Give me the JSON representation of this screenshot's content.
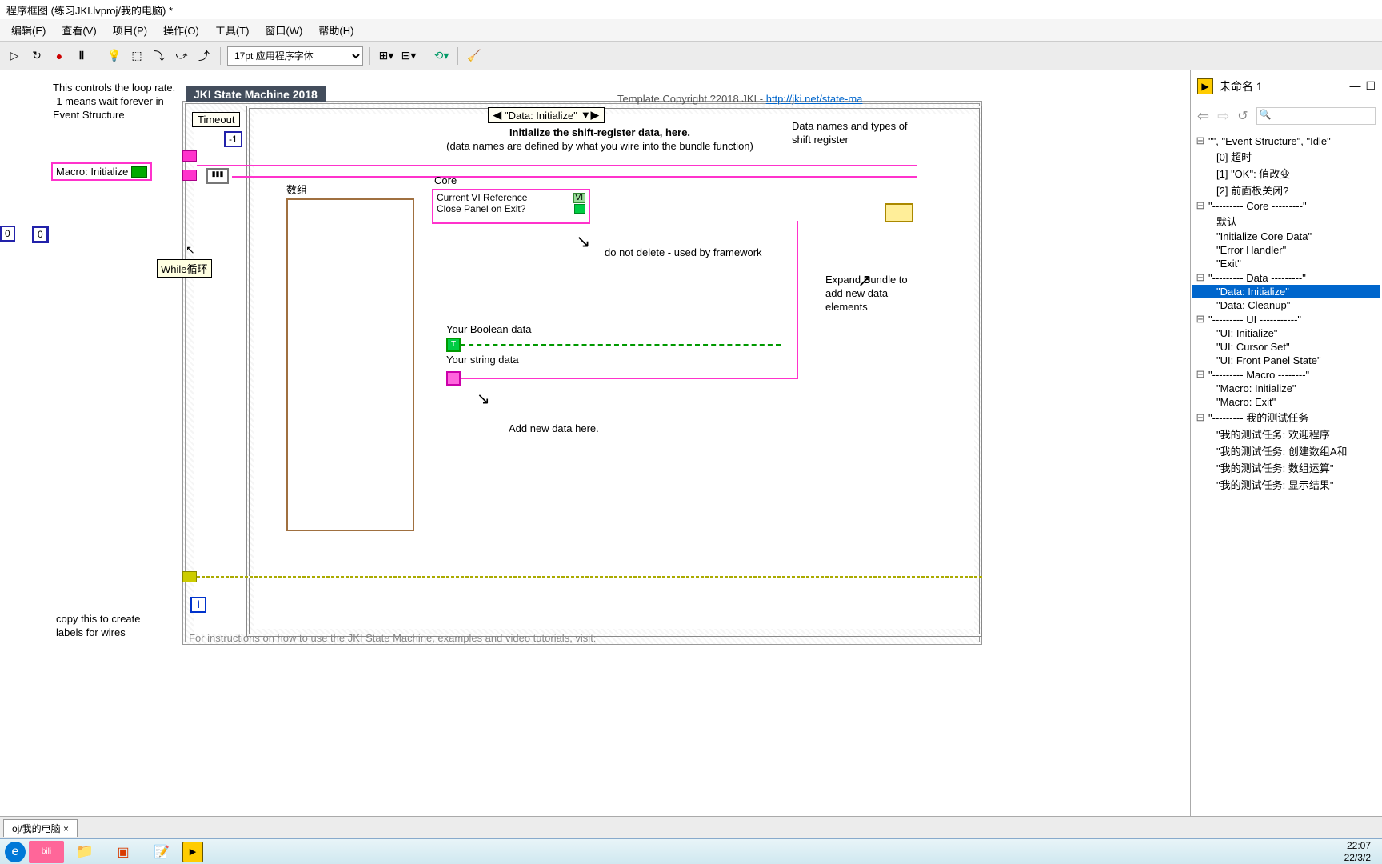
{
  "window": {
    "title": "程序框图 (练习JKI.lvproj/我的电脑) *"
  },
  "menu": {
    "edit": "编辑(E)",
    "view": "查看(V)",
    "project": "项目(P)",
    "operate": "操作(O)",
    "tools": "工具(T)",
    "window": "窗口(W)",
    "help": "帮助(H)"
  },
  "toolbar": {
    "font": "17pt 应用程序字体"
  },
  "right_panel": {
    "title": "未命名 1",
    "search_ph": "",
    "items": [
      {
        "t": "\"\", \"Event Structure\", \"Idle\"",
        "i": 0,
        "g": true
      },
      {
        "t": "[0] 超时",
        "i": 1
      },
      {
        "t": "[1] \"OK\": 值改变",
        "i": 1
      },
      {
        "t": "[2] 前面板关闭?",
        "i": 1
      },
      {
        "t": "\"--------- Core ---------\"",
        "i": 0,
        "g": true
      },
      {
        "t": "默认",
        "i": 1
      },
      {
        "t": "\"Initialize Core Data\"",
        "i": 1
      },
      {
        "t": "\"Error Handler\"",
        "i": 1
      },
      {
        "t": "\"Exit\"",
        "i": 1
      },
      {
        "t": "\"--------- Data ---------\"",
        "i": 0,
        "g": true
      },
      {
        "t": "\"Data: Initialize\"",
        "i": 1,
        "sel": true
      },
      {
        "t": "\"Data: Cleanup\"",
        "i": 1
      },
      {
        "t": "\"--------- UI -----------\"",
        "i": 0,
        "g": true
      },
      {
        "t": "\"UI: Initialize\"",
        "i": 1
      },
      {
        "t": "\"UI: Cursor Set\"",
        "i": 1
      },
      {
        "t": "\"UI: Front Panel State\"",
        "i": 1
      },
      {
        "t": "\"--------- Macro --------\"",
        "i": 0,
        "g": true
      },
      {
        "t": "\"Macro: Initialize\"",
        "i": 1
      },
      {
        "t": "\"Macro: Exit\"",
        "i": 1
      },
      {
        "t": "\"--------- 我的测试任务",
        "i": 0,
        "g": true
      },
      {
        "t": "\"我的测试任务: 欢迎程序",
        "i": 1
      },
      {
        "t": "\"我的测试任务: 创建数组A和",
        "i": 1
      },
      {
        "t": "\"我的测试任务: 数组运算\"",
        "i": 1
      },
      {
        "t": "\"我的测试任务: 显示结果\"",
        "i": 1
      }
    ]
  },
  "diagram": {
    "jki_title": "JKI State Machine 2018",
    "copyright_pre": "Template Copyright ?2018 JKI - ",
    "copyright_link": "http://jki.net/state-ma",
    "loop_comment": "This controls the loop rate. -1 means wait forever in Event Structure",
    "timeout": "Timeout",
    "timeout_val": "-1",
    "macro_init": "Macro: Initialize",
    "case_label": "\"Data: Initialize\"",
    "init_title": "Initialize the shift-register data, here.",
    "init_sub": "(data names are defined by what you wire into the bundle function)",
    "core": "Core",
    "vi_ref": "Current VI Reference",
    "close_panel": "Close Panel on Exit?",
    "array_label": "数组",
    "no_delete": "do not delete - used by framework",
    "data_names": "Data names and types of shift register",
    "expand": "Expand Bundle to add new data elements",
    "bool_data": "Your Boolean data",
    "str_data": "Your string data",
    "add_data": "Add new data here.",
    "while_tip": "While循环",
    "copy_label": "copy this to create labels for wires",
    "footer": "For instructions on how to use the JKI State Machine, examples and video tutorials, visit:",
    "num0a": "0",
    "num0b": "0"
  },
  "tab": "oj/我的电脑",
  "clock": {
    "time": "22:07",
    "date": "22/3/2"
  }
}
